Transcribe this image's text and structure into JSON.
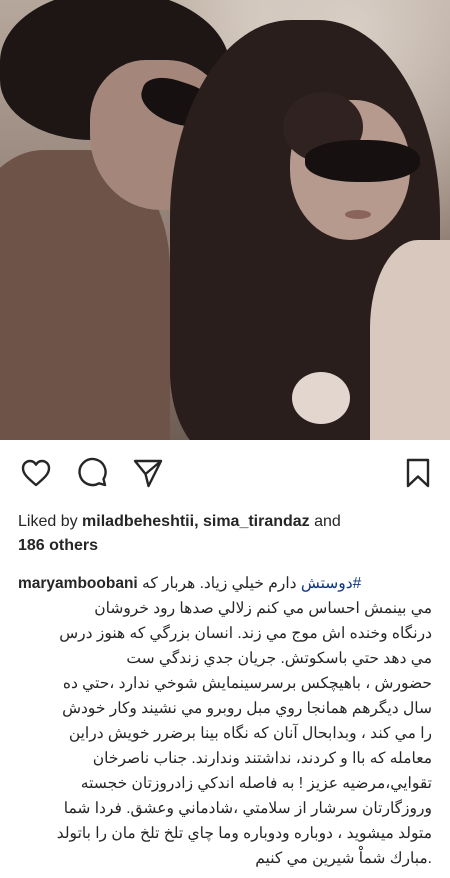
{
  "post": {
    "photo_alt": "Black and white photo of a man and a woman in sunglasses and headscarf",
    "actions": {
      "like_icon": "heart-outline-icon",
      "comment_icon": "comment-bubble-icon",
      "share_icon": "paper-plane-icon",
      "save_icon": "bookmark-outline-icon"
    },
    "likes": {
      "prefix": "Liked by ",
      "user1": "miladbeheshtii",
      "separator": ", ",
      "user2": "sima_tirandaz",
      "and": " and",
      "others_count": "186 others"
    },
    "caption": {
      "username": "maryamboobani",
      "hashtag": "#دوستش",
      "first_line_rest": " دارم خيلي زياد. هربار كه",
      "lines": [
        "مي بينمش احساس مي كنم زلالي صدها رود خروشان",
        "درنگاه وخنده اش موج مي زند. انسان بزرگي كه هنوز درس",
        "مي دهد حتي باسكوتش. جريان جدي زندگي ست",
        "حضورش ، باهيچكس برسرسينمايش شوخي ندارد ،حتي ده",
        "سال ديگرهم همانجا روي مبل روبرو مي نشيند وكار خودش",
        "را مي كند ، وبدابحال آنان كه نگاه بينا برضرر خويش دراين",
        "معامله كه باا و كردند، نداشتند وندارند. جناب ناصرخان",
        "تقوايي،مرضيه عزيز ! به فاصله اندكي زادروزتان خجسته",
        "وروزگارتان سرشار از سلامتي ،شادماني وعشق. فردا شما",
        "متولد ميشويد ، دوباره ودوباره وما چاي تلخ تلخ مان را باتولد",
        ".مبارك شماْ شيرين مي كنيم"
      ]
    }
  }
}
